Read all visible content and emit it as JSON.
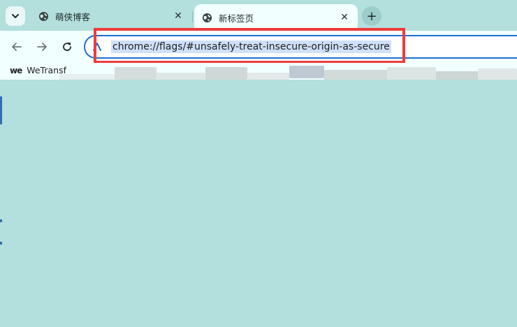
{
  "tabs": [
    {
      "title": "萌侠博客",
      "icon": "globe-icon",
      "active": false
    },
    {
      "title": "新标签页",
      "icon": "globe-icon",
      "active": true
    }
  ],
  "toolbar": {
    "address": "chrome://flags/#unsafely-treat-insecure-origin-as-secure"
  },
  "bookmarks": [
    {
      "label": "WeTransf",
      "icon": "wetransfer-icon",
      "icon_text": "we"
    }
  ],
  "colors": {
    "frame": "#b3dfdc",
    "toolbar": "#f2ffff",
    "omnibox_border": "#1a6fd1",
    "selection": "#cfe0fb",
    "highlight": "#ef3b3b"
  }
}
